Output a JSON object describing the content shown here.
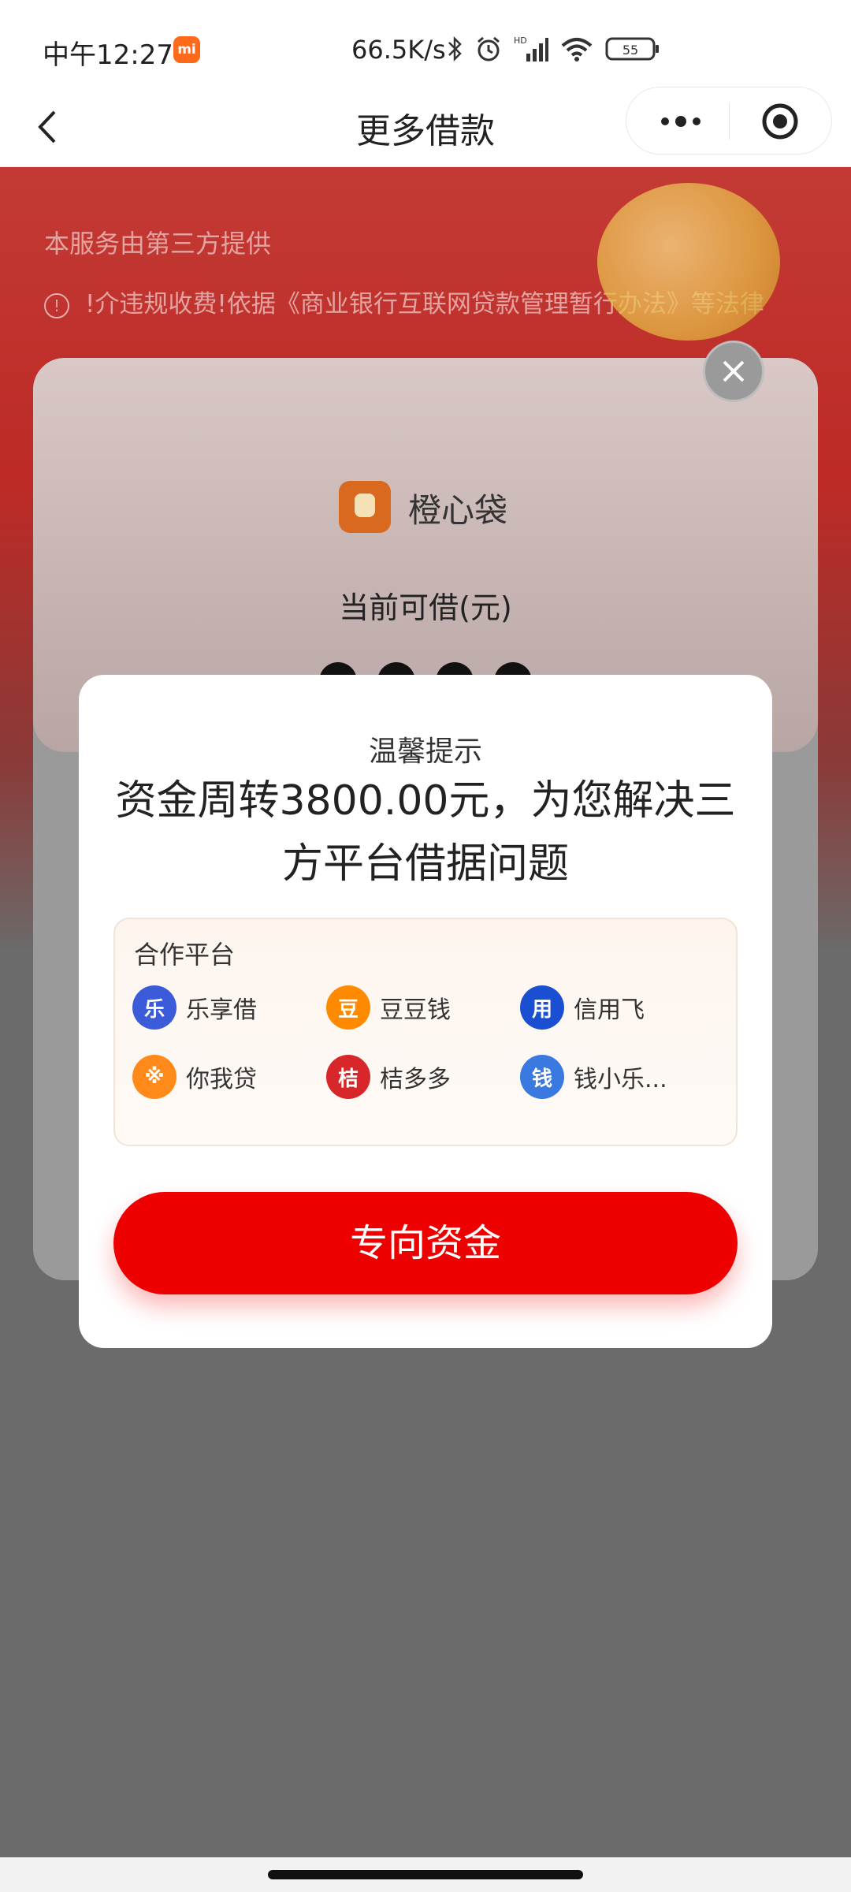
{
  "status_bar": {
    "time": "中午12:27",
    "mi_label": "mi",
    "net_speed": "66.5K/s",
    "battery": "55"
  },
  "title_bar": {
    "title": "更多借款"
  },
  "background": {
    "provider_note": "本服务由第三方提供",
    "warning_text": "!介违规收费!依据《商业银行互联网贷款管理暂行办法》等法律",
    "lender_name": "橙心袋",
    "can_borrow_label": "当前可借(元)"
  },
  "modal": {
    "subtitle": "温馨提示",
    "title": "资金周转3800.00元，为您解决三方平台借据问题",
    "partners_heading": "合作平台",
    "partners": [
      {
        "name": "乐享借",
        "icon": "lexiangjie-icon",
        "color": "#3b5bd8",
        "glyph": "乐"
      },
      {
        "name": "豆豆钱",
        "icon": "doudouqian-icon",
        "color": "#ff8a00",
        "glyph": "豆"
      },
      {
        "name": "信用飞",
        "icon": "xinyongfei-icon",
        "color": "#1a4fd1",
        "glyph": "用"
      },
      {
        "name": "你我贷",
        "icon": "niwodai-icon",
        "color": "#ff8a1a",
        "glyph": "※"
      },
      {
        "name": "桔多多",
        "icon": "juduoduo-icon",
        "color": "#d8272a",
        "glyph": "桔"
      },
      {
        "name": "钱小乐...",
        "icon": "qianxiaole-icon",
        "color": "#3a79e0",
        "glyph": "钱"
      }
    ],
    "cta_label": "专向资金"
  },
  "colors": {
    "primary_red": "#ef0000",
    "overlay_gray": "#6b6b6b"
  }
}
